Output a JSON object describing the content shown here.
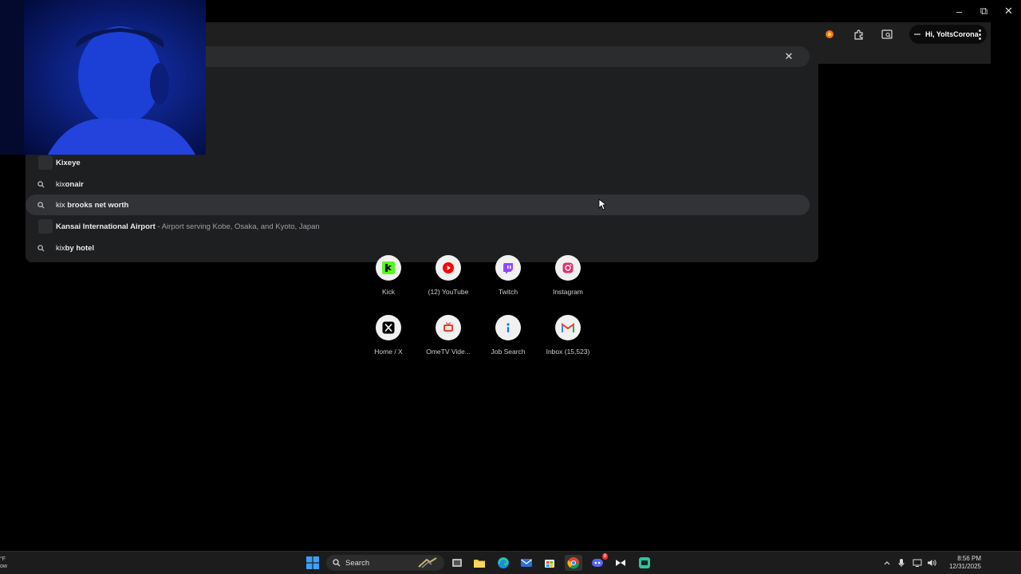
{
  "window_controls": {
    "minimize": "–",
    "restore": "⧉",
    "close": "✕"
  },
  "toolbar": {
    "profile_label": "Hi, YoltsCorona"
  },
  "omnibox": {
    "value": "",
    "clear_label": "✕"
  },
  "suggestions": [
    {
      "type": "site",
      "match": "Kix",
      "rest": "eye",
      "desc": ""
    },
    {
      "type": "search",
      "match": "kix",
      "rest": "onair",
      "desc": ""
    },
    {
      "type": "search",
      "match": "kix",
      "rest": " brooks net worth",
      "desc": ""
    },
    {
      "type": "entity",
      "match": "Kansai International Airport",
      "rest": "",
      "desc": " - Airport serving Kobe, Osaka, and Kyoto, Japan"
    },
    {
      "type": "search",
      "match": "kix",
      "rest": "by hotel",
      "desc": ""
    }
  ],
  "shortcuts": [
    {
      "label": "Kick",
      "icon": "kick-icon",
      "color": "#53fc18"
    },
    {
      "label": "(12) YouTube",
      "icon": "youtube-icon",
      "color": "#ff0000"
    },
    {
      "label": "Twitch",
      "icon": "twitch-icon",
      "color": "#9146ff"
    },
    {
      "label": "Instagram",
      "icon": "instagram-icon",
      "color": "#e1306c"
    },
    {
      "label": "Home / X",
      "icon": "x-icon",
      "color": "#000000"
    },
    {
      "label": "OmeTV Vide...",
      "icon": "ometv-icon",
      "color": "#e2463a"
    },
    {
      "label": "Job Search",
      "icon": "job-search-icon",
      "color": "#1a73e8"
    },
    {
      "label": "Inbox (15,523)",
      "icon": "gmail-icon",
      "color": "#ea4335"
    }
  ],
  "taskbar": {
    "search_label": "Search",
    "clock_time": "8:56 PM",
    "clock_date": "12/31/2025",
    "weather_top": "°F",
    "weather_bottom": "ow",
    "discord_badge": "9"
  }
}
